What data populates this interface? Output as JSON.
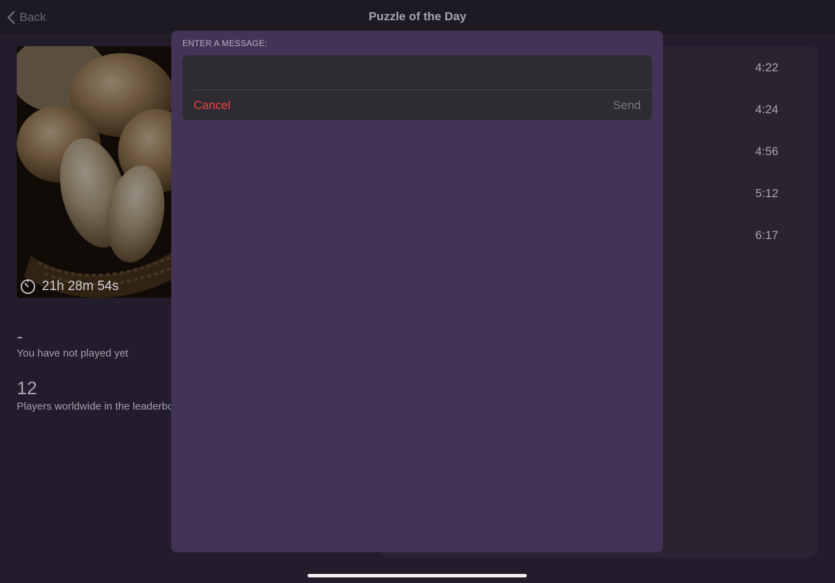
{
  "nav": {
    "back_label": "Back",
    "title": "Puzzle of the Day"
  },
  "puzzle": {
    "image_icon": "bread-basket-photo",
    "timer_icon": "timer-icon",
    "timer": "21h 28m 54s"
  },
  "stats": {
    "own_result": "-",
    "own_result_label": "You have not played yet",
    "players_count": "12",
    "players_label": "Players worldwide in the leaderboard"
  },
  "leaderboard": {
    "times": [
      "4:22",
      "4:24",
      "4:56",
      "5:12",
      "6:17"
    ]
  },
  "modal": {
    "header": "ENTER A MESSAGE:",
    "input_value": "",
    "input_placeholder": "",
    "cancel_label": "Cancel",
    "send_label": "Send"
  },
  "colors": {
    "accent_cancel": "#e8473f",
    "modal_background": "#433356",
    "page_background": "#221c2c"
  }
}
